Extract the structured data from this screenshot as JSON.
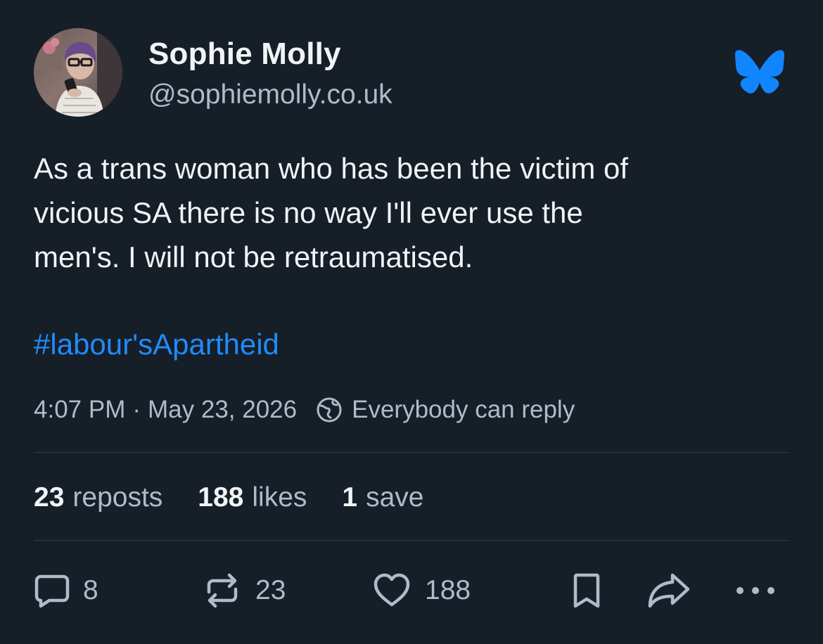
{
  "author": {
    "display_name": "Sophie Molly",
    "handle": "@sophiemolly.co.uk"
  },
  "post": {
    "text_lines": [
      "As a trans woman who has been the victim of",
      "vicious SA there is no way I'll ever use the",
      "men's. I will not be retraumatised."
    ],
    "hashtag": "#labour'sApartheid"
  },
  "meta": {
    "time": "4:07 PM",
    "separator": "·",
    "date": "May 23, 2026",
    "reply_setting": "Everybody can reply"
  },
  "stats": {
    "reposts_count": "23",
    "reposts_label": "reposts",
    "likes_count": "188",
    "likes_label": "likes",
    "saves_count": "1",
    "saves_label": "save"
  },
  "actions": {
    "reply_count": "8",
    "repost_count": "23",
    "like_count": "188"
  },
  "icons": {
    "brand": "bluesky-butterfly-icon",
    "reply": "speech-bubble-icon",
    "repost": "repost-arrows-icon",
    "like": "heart-icon",
    "bookmark": "bookmark-icon",
    "share": "share-arrow-icon",
    "more": "more-ellipsis-icon",
    "reply_setting": "globe-icon"
  },
  "colors": {
    "background": "#161e27",
    "text": "#f1f3f5",
    "muted": "#aebbc9",
    "accent": "#208bfe",
    "brand_blue": "#1185fe",
    "divider": "#2e3b49"
  }
}
